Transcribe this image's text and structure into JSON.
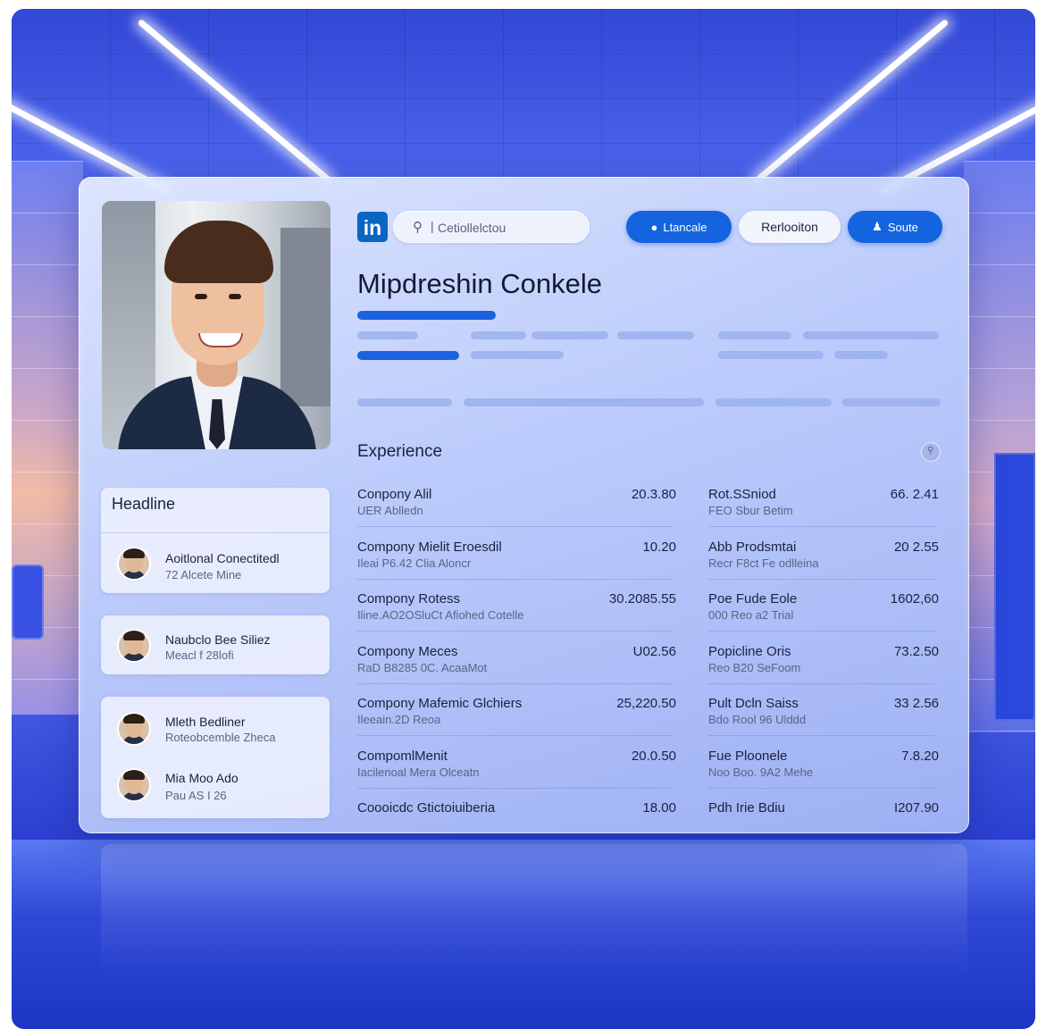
{
  "app": {
    "logo_text": "in"
  },
  "search": {
    "placeholder": "Cetiollelctou"
  },
  "header": {
    "buttons": [
      {
        "label": "Ltancale",
        "icon": "message-icon"
      },
      {
        "label": "Rerlooiton",
        "icon": ""
      },
      {
        "label": "Soute",
        "icon": "people-icon"
      }
    ]
  },
  "profile": {
    "name": "Mipdreshin Conkele"
  },
  "sidebar": {
    "headline_title": "Headline",
    "people": [
      {
        "name": "Aoitlonal Conectitedl",
        "sub": "72 Alcete Mine"
      },
      {
        "name": "Naubclo Bee Siliez",
        "sub": "Meacl f 28lofi"
      },
      {
        "name": "Mleth Bedliner",
        "sub": "Roteobcemble Zheca"
      },
      {
        "name": "Mia Moo Ado",
        "sub": "Pau AS I 26"
      }
    ]
  },
  "experience": {
    "title": "Experience",
    "left": [
      {
        "title": "Conpony Alil",
        "sub": "UER Ablledn",
        "value": "20.3.80"
      },
      {
        "title": "Compony Mielit Eroesdil",
        "sub": "Ileai P6.42 Clia Aloncr",
        "value": "10.20"
      },
      {
        "title": "Compony Rotess",
        "sub": "Iline.AO2OSluCt Afiohed Cotelle",
        "value": "30.2085.55"
      },
      {
        "title": "Compony Meces",
        "sub": "RaD B8285 0C. AcaaMot",
        "value": "U02.56"
      },
      {
        "title": "Compony Mafemic Glchiers",
        "sub": "Ileeain.2D Reoa",
        "value": "25,220.50"
      },
      {
        "title": "CompomlMenit",
        "sub": "Iacilenoal Mera Olceatn",
        "value": "20.0.50"
      },
      {
        "title": "Coooicdc Gtictoiuiberia",
        "sub": "",
        "value": "18.00"
      }
    ],
    "right": [
      {
        "title": "Rot.SSniod",
        "sub": "FEO Sbur Betim",
        "value": "66. 2.41"
      },
      {
        "title": "Abb Prodsmtai",
        "sub": "Recr F8ct Fe odlleina",
        "value": "20 2.55"
      },
      {
        "title": "Poe Fude Eole",
        "sub": "000 Reo a2 Trial",
        "value": "1602,60"
      },
      {
        "title": "Popicline Oris",
        "sub": "Reo B20 SeFoom",
        "value": "73.2.50"
      },
      {
        "title": "Pult Dcln Saiss",
        "sub": "Bdo Rool 96 Ulddd",
        "value": "33 2.56"
      },
      {
        "title": "Fue Ploonele",
        "sub": "Noo Boo. 9A2 Mehe",
        "value": "7.8.20"
      },
      {
        "title": "Pdh Irie Bdiu",
        "sub": "",
        "value": "I207.90"
      }
    ]
  },
  "colors": {
    "brand": "#0a66c2",
    "accent": "#1464e0"
  }
}
